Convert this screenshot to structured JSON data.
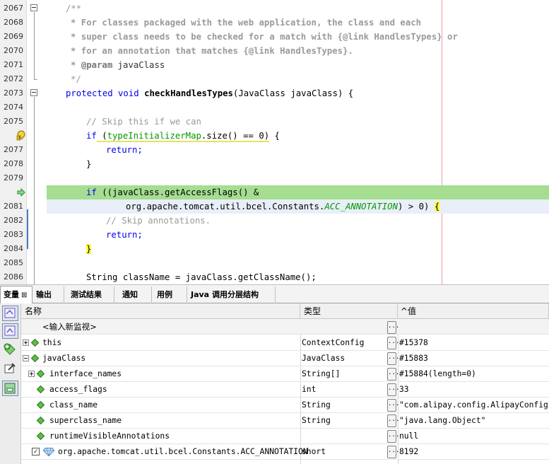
{
  "editor": {
    "line_numbers": [
      "2067",
      "2068",
      "2069",
      "2070",
      "2071",
      "2072",
      "2073",
      "2074",
      "2075",
      "",
      "2077",
      "2078",
      "2079",
      "",
      "2081",
      "2082",
      "2083",
      "2084",
      "2085",
      "2086"
    ],
    "lines": {
      "l2067": "/**",
      "l2068": "* For classes packaged with the web application, the class and each",
      "l2069_a": "* super class needs to be checked for a match with ",
      "l2069_b": "{@link HandlesTypes}",
      "l2069_c": " or",
      "l2070_a": "* for an annotation that matches ",
      "l2070_b": "{@link HandlesTypes}",
      "l2070_c": ".",
      "l2071_a": "* ",
      "l2071_b": "@param",
      "l2071_c": " javaClass",
      "l2072": "*/",
      "l2073_a": "protected void ",
      "l2073_b": "checkHandlesTypes",
      "l2073_c": "(JavaClass javaClass) {",
      "l2075": "// Skip this if we can",
      "l2076_a": "if",
      "l2076_b": " (",
      "l2076_c": "typeInitializerMap",
      "l2076_d": ".size() == 0)",
      "l2076_e": " {",
      "l2077": "return;",
      "l2078": "}",
      "l2080_a": "if",
      "l2080_b": " ((javaClass.getAccessFlags() &",
      "l2081_a": "org.apache.tomcat.util.bcel.Constants.",
      "l2081_b": "ACC_ANNOTATION",
      "l2081_c": ") > 0) ",
      "l2081_d": "{",
      "l2082": "// Skip annotations.",
      "l2083": "return;",
      "l2084": "}",
      "l2086": "String className = javaClass.getClassName();"
    }
  },
  "tabs": [
    {
      "label": "变量",
      "close": "⊠"
    },
    {
      "label": "输出"
    },
    {
      "label": "测试结果"
    },
    {
      "label": "通知"
    },
    {
      "label": "用例"
    },
    {
      "label": "Java 调用分层结构"
    }
  ],
  "variables": {
    "columns": {
      "name": "名称",
      "type": "类型",
      "value": "^值"
    },
    "new_watch": "<输入新监视>",
    "dots": "...",
    "rows": [
      {
        "name": "this",
        "type": "ContextConfig",
        "value": "#15378"
      },
      {
        "name": "javaClass",
        "type": "JavaClass",
        "value": "#15883"
      },
      {
        "name": "interface_names",
        "type": "String[]",
        "value": "#15884(length=0)"
      },
      {
        "name": "access_flags",
        "type": "int",
        "value": "33"
      },
      {
        "name": "class_name",
        "type": "String",
        "value": "\"com.alipay.config.AlipayConfig\""
      },
      {
        "name": "superclass_name",
        "type": "String",
        "value": "\"java.lang.Object\""
      },
      {
        "name": "runtimeVisibleAnnotations",
        "type": "",
        "value": "null"
      },
      {
        "name": "org.apache.tomcat.util.bcel.Constants.ACC_ANNOTATION",
        "type": "short",
        "value": "8192"
      }
    ],
    "watch_checked": "✓"
  },
  "colors": {
    "keyword": "#0000e6",
    "comment": "#9a9a9a",
    "field": "#009900",
    "current_line": "#a5dd91",
    "caret_line": "#e9eff8",
    "brace_match": "#ffff40",
    "diamond": "#3aa13a"
  }
}
